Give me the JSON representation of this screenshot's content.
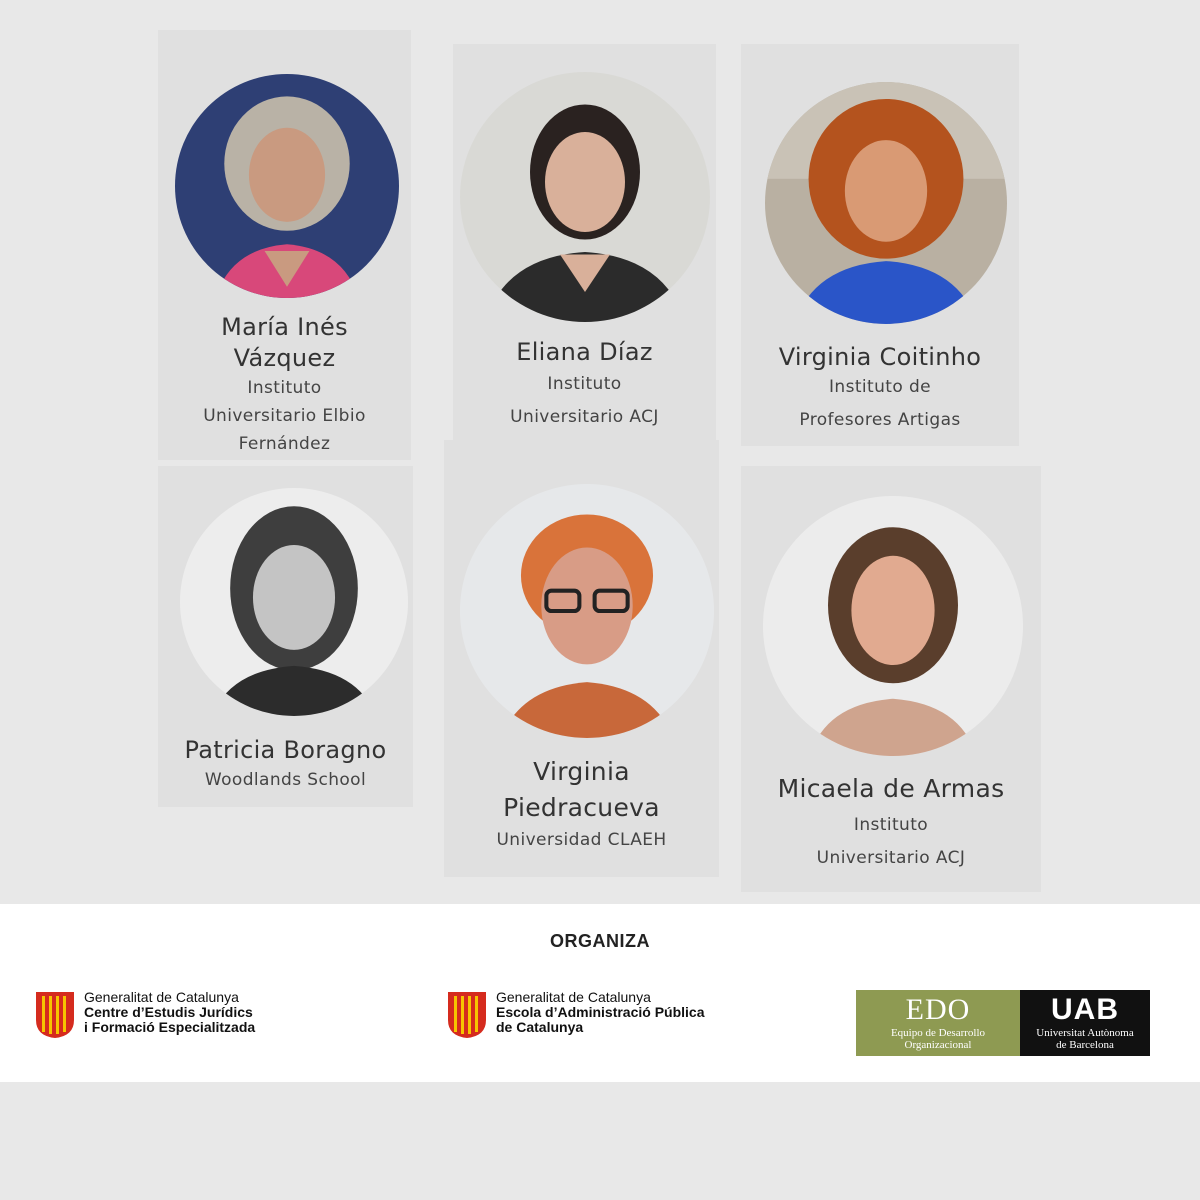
{
  "people": [
    {
      "name_lines": [
        "María Inés",
        "Vázquez"
      ],
      "affiliation_lines": [
        "Instituto",
        "Universitario Elbio",
        "Fernández"
      ]
    },
    {
      "name_lines": [
        "Eliana Díaz"
      ],
      "affiliation_lines": [
        "Instituto",
        "Universitario ACJ"
      ]
    },
    {
      "name_lines": [
        "Virginia Coitinho"
      ],
      "affiliation_lines": [
        "Instituto de",
        "Profesores Artigas"
      ]
    },
    {
      "name_lines": [
        "Patricia Boragno"
      ],
      "affiliation_lines": [
        "Woodlands School"
      ]
    },
    {
      "name_lines": [
        "Virginia",
        "Piedracueva"
      ],
      "affiliation_lines": [
        "Universidad CLAEH"
      ]
    },
    {
      "name_lines": [
        "Micaela de Armas"
      ],
      "affiliation_lines": [
        "Instituto",
        "Universitario ACJ"
      ]
    }
  ],
  "footer": {
    "heading": "ORGANIZA",
    "logo1": {
      "line1": "Generalitat de Catalunya",
      "line2": "Centre d’Estudis Jurídics",
      "line3": "i Formació Especialitzada"
    },
    "logo2": {
      "line1": "Generalitat de Catalunya",
      "line2": "Escola d’Administració Pública",
      "line3": "de Catalunya"
    },
    "edo": {
      "title": "EDO",
      "sub1": "Equipo de Desarrollo",
      "sub2": "Organizacional"
    },
    "uab": {
      "title": "UAB",
      "sub1": "Universitat Autònoma",
      "sub2": "de Barcelona"
    }
  }
}
